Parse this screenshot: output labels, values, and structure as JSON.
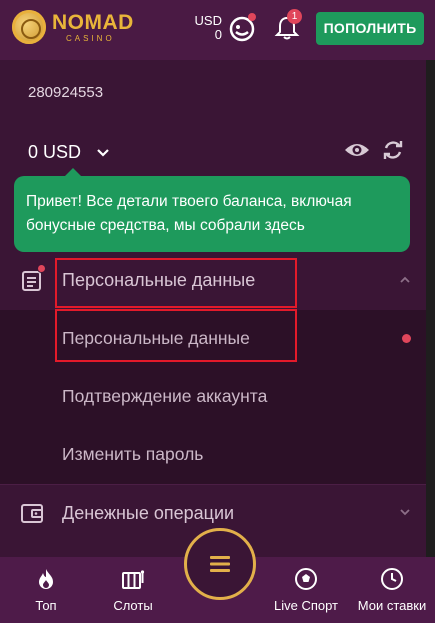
{
  "header": {
    "brand": "NOMAD",
    "brand_sub": "CASINO",
    "currency_code": "USD",
    "currency_amount": "0",
    "notifications_count": "1",
    "topup_label": "ПОПОЛНИТЬ"
  },
  "account": {
    "id": "280924553",
    "balance": "0 USD"
  },
  "tooltip": {
    "text": "Привет! Все детали твоего баланса, включая бонусные средства, мы собрали здесь"
  },
  "menu": {
    "personal": {
      "title": "Персональные данные",
      "items": [
        {
          "label": "Персональные данные"
        },
        {
          "label": "Подтверждение аккаунта"
        },
        {
          "label": "Изменить пароль"
        }
      ]
    },
    "money": {
      "title": "Денежные операции"
    }
  },
  "bottom_nav": {
    "items": [
      {
        "label": "Топ",
        "icon": "fire-icon"
      },
      {
        "label": "Слоты",
        "icon": "slots-icon"
      },
      {
        "label": "Live Спорт",
        "icon": "soccer-ball-icon"
      },
      {
        "label": "Мои ставки",
        "icon": "clock-icon"
      }
    ]
  },
  "colors": {
    "accent_green": "#1e9a5c",
    "brand_gold": "#e9b53a",
    "highlight_red": "#e31a2a",
    "badge_red": "#e0465b",
    "bg_purple": "#3a1535"
  }
}
